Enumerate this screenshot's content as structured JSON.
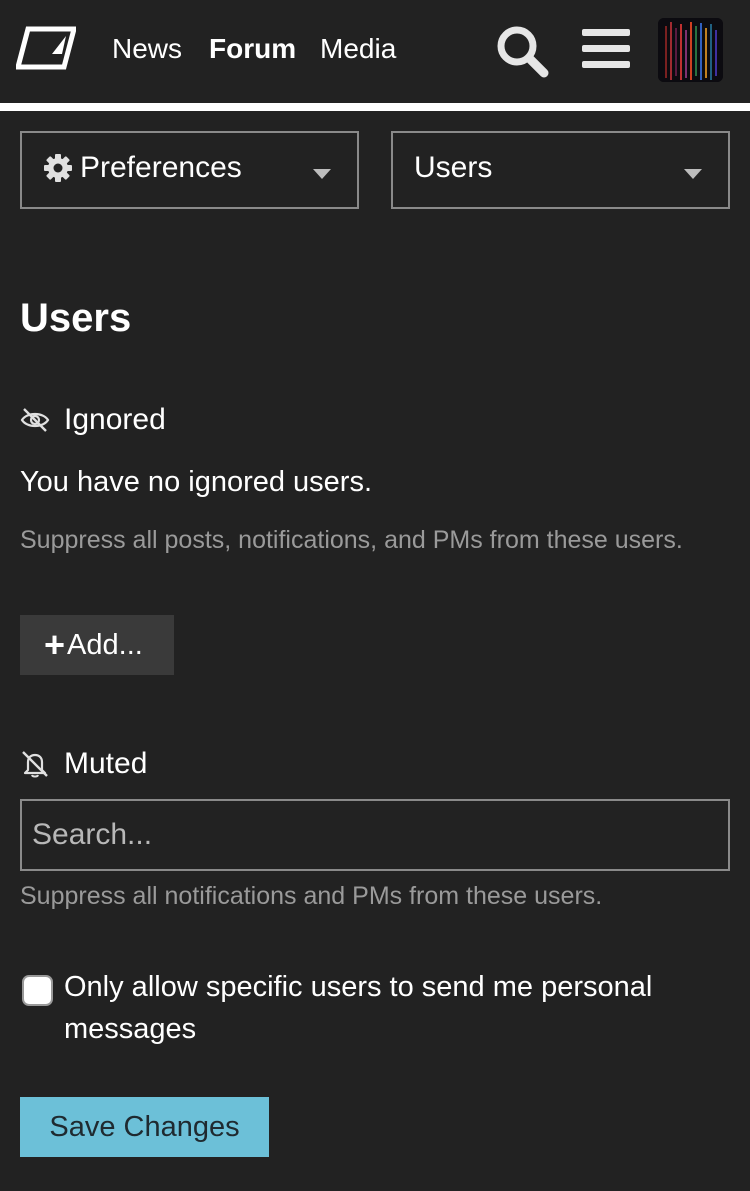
{
  "nav": {
    "links": [
      "News",
      "Forum",
      "Media"
    ],
    "active": "Forum"
  },
  "icons": {
    "logo": "site-logo",
    "search": "search-icon",
    "menu": "hamburger-menu-icon",
    "gear": "gear-icon",
    "caret": "caret-down-icon",
    "ignored": "eye-slash-icon",
    "muted": "bell-slash-icon",
    "add": "plus-icon"
  },
  "selects": {
    "preferences_label": "Preferences",
    "users_label": "Users"
  },
  "page": {
    "title": "Users"
  },
  "ignored": {
    "heading": "Ignored",
    "empty_message": "You have no ignored users.",
    "help": "Suppress all posts, notifications, and PMs from these users.",
    "add_label": "Add..."
  },
  "muted": {
    "heading": "Muted",
    "search_placeholder": "Search...",
    "help": "Suppress all notifications and PMs from these users."
  },
  "pm_option": {
    "label": "Only allow specific users to send me personal messages",
    "checked": false
  },
  "save_label": "Save Changes",
  "colors": {
    "background": "#222222",
    "save_button": "#6cc0d8",
    "muted_text": "#9a9a9a",
    "border": "#8a8a8a"
  }
}
